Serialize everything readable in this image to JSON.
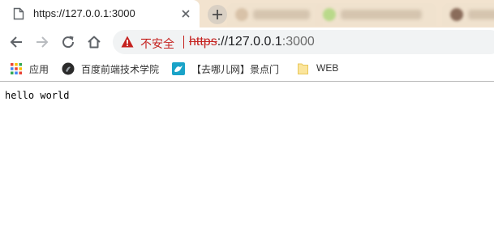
{
  "tabs": {
    "active": {
      "title": "https://127.0.0.1:3000"
    }
  },
  "toolbar": {
    "security": {
      "label": "不安全"
    },
    "url": {
      "scheme": "https",
      "separator": "://",
      "host": "127.0.0.1",
      "port": ":3000"
    }
  },
  "bookmarks": {
    "items": [
      {
        "label": "应用",
        "icon": "apps-grid-icon"
      },
      {
        "label": "百度前端技术学院",
        "icon": "baidu-ife-icon"
      },
      {
        "label": "【去哪儿网】景点门",
        "icon": "qunar-icon"
      },
      {
        "label": "WEB",
        "icon": "folder-icon"
      }
    ]
  },
  "page": {
    "body_text": "hello world"
  },
  "colors": {
    "tab_strip": "#f2e3cf",
    "insecure_red": "#c5221f",
    "omnibox_bg": "#f1f3f4"
  }
}
